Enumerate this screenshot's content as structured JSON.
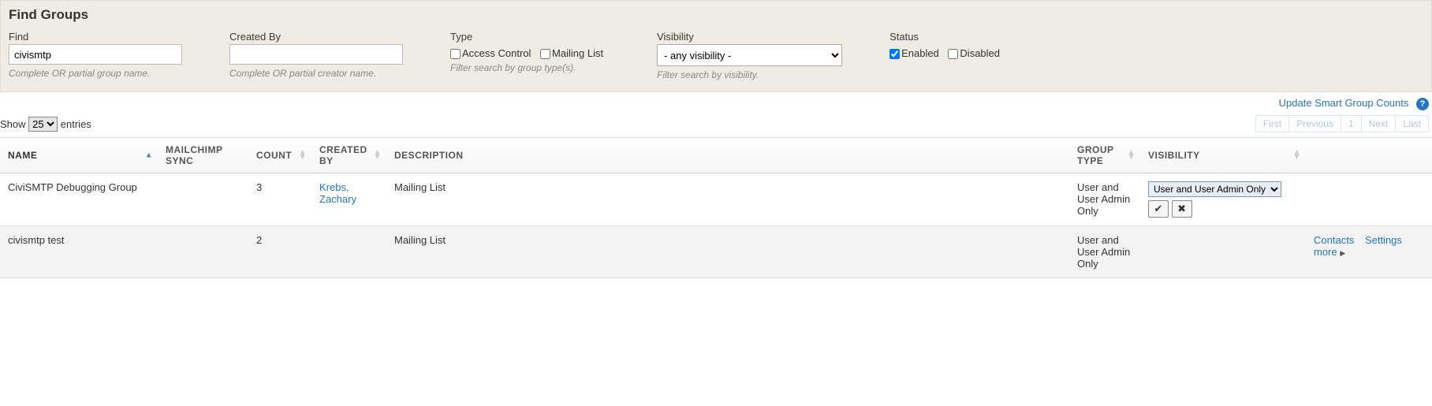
{
  "panel_title": "Find Groups",
  "find": {
    "label": "Find",
    "value": "civismtp",
    "hint": "Complete OR partial group name."
  },
  "created_by": {
    "label": "Created By",
    "value": "",
    "hint": "Complete OR partial creator name."
  },
  "type": {
    "label": "Type",
    "access_control": "Access Control",
    "mailing_list": "Mailing List",
    "hint": "Filter search by group type(s)."
  },
  "visibility": {
    "label": "Visibility",
    "selected": "- any visibility -",
    "hint": "Filter search by visibility."
  },
  "status": {
    "label": "Status",
    "enabled": "Enabled",
    "disabled": "Disabled"
  },
  "update_link": "Update Smart Group Counts",
  "length": {
    "show": "Show",
    "value": "25",
    "entries": "entries"
  },
  "pager": {
    "first": "First",
    "previous": "Previous",
    "page": "1",
    "next": "Next",
    "last": "Last"
  },
  "columns": {
    "name": "NAME",
    "mc": "MAILCHIMP SYNC",
    "count": "COUNT",
    "created_by": "CREATED BY",
    "description": "DESCRIPTION",
    "group_type": "GROUP TYPE",
    "visibility": "VISIBILITY"
  },
  "rows": [
    {
      "name": "CiviSMTP Debugging Group",
      "count": "3",
      "created_by": "Krebs, Zachary",
      "description": "Mailing List",
      "group_type": "User and User Admin Only",
      "visibility_edit": "User and User Admin Only"
    },
    {
      "name": "civismtp test",
      "count": "2",
      "created_by": "",
      "description": "Mailing List",
      "group_type": "User and User Admin Only"
    }
  ],
  "actions": {
    "contacts": "Contacts",
    "settings": "Settings",
    "more": "more"
  }
}
